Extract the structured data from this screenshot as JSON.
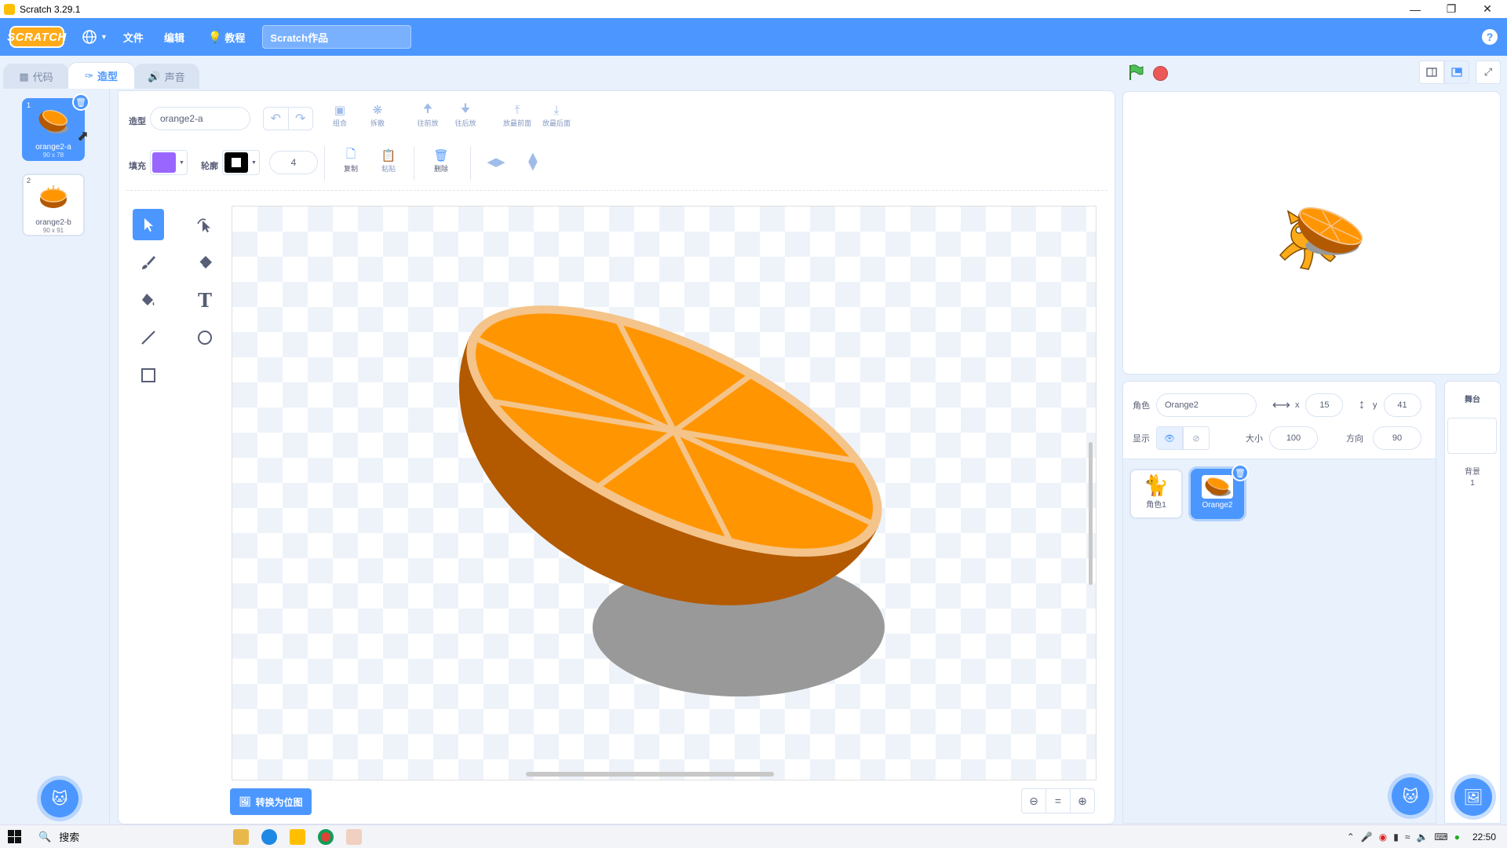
{
  "window": {
    "title": "Scratch 3.29.1",
    "controls": [
      "minimize",
      "restore",
      "close"
    ]
  },
  "menubar": {
    "logo": "SCRATCH",
    "file": "文件",
    "edit": "编辑",
    "tutorials": "教程",
    "project_title": "Scratch作品"
  },
  "tabs": {
    "code": "代码",
    "costumes": "造型",
    "sounds": "声音"
  },
  "costumes": [
    {
      "index": "1",
      "name": "orange2-a",
      "size": "90 x 78"
    },
    {
      "index": "2",
      "name": "orange2-b",
      "size": "90 x 91"
    }
  ],
  "paint": {
    "costume_label": "造型",
    "costume_name": "orange2-a",
    "fill_label": "填充",
    "outline_label": "轮廓",
    "outline_width": "4",
    "fill_color": "#9966ff",
    "outline_color": "#000000",
    "group": "组合",
    "ungroup": "拆散",
    "forward": "往前放",
    "backward": "往后放",
    "front": "放最前面",
    "back": "放最后面",
    "copy": "复制",
    "paste": "粘贴",
    "delete": "删除",
    "convert_bitmap": "转换为位图"
  },
  "sprite_info": {
    "sprite_label": "角色",
    "sprite_name": "Orange2",
    "x_label": "x",
    "x": "15",
    "y_label": "y",
    "y": "41",
    "show_label": "显示",
    "size_label": "大小",
    "size": "100",
    "direction_label": "方向",
    "direction": "90"
  },
  "sprites": [
    {
      "name": "角色1"
    },
    {
      "name": "Orange2"
    }
  ],
  "stage_pane": {
    "title": "舞台",
    "backdrops_label": "背景",
    "backdrops_count": "1"
  },
  "taskbar": {
    "search": "搜索",
    "time": "22:50"
  },
  "colors": {
    "accent": "#4c97ff",
    "orange": "#ff9500",
    "rind": "#b35900",
    "pith": "#f4c48a",
    "shadow": "#999999"
  }
}
